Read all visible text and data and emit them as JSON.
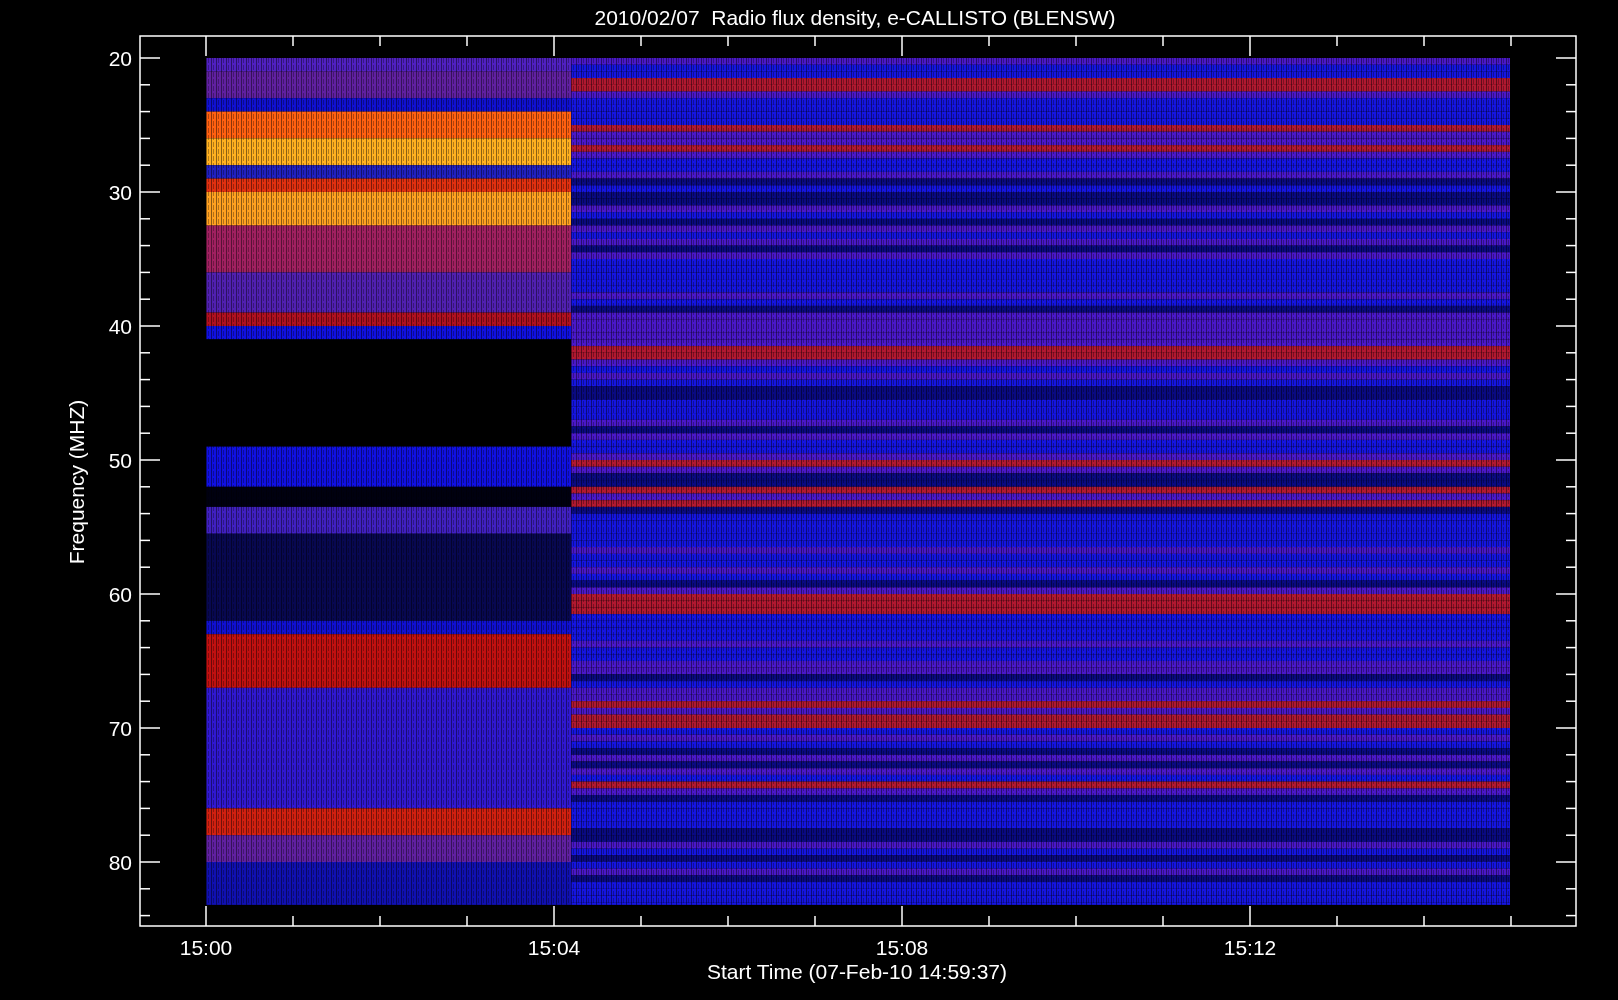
{
  "plot": {
    "title": "2010/02/07  Radio flux density, e-CALLISTO (BLENSW)",
    "y_axis": {
      "label": "Frequency (MHZ)",
      "ticks": [
        "20",
        "30",
        "40",
        "50",
        "60",
        "70",
        "80"
      ]
    },
    "x_axis": {
      "label": "Start Time (07-Feb-10 14:59:37)",
      "ticks": [
        "15:00",
        "15:04",
        "15:08",
        "15:12"
      ]
    }
  }
}
